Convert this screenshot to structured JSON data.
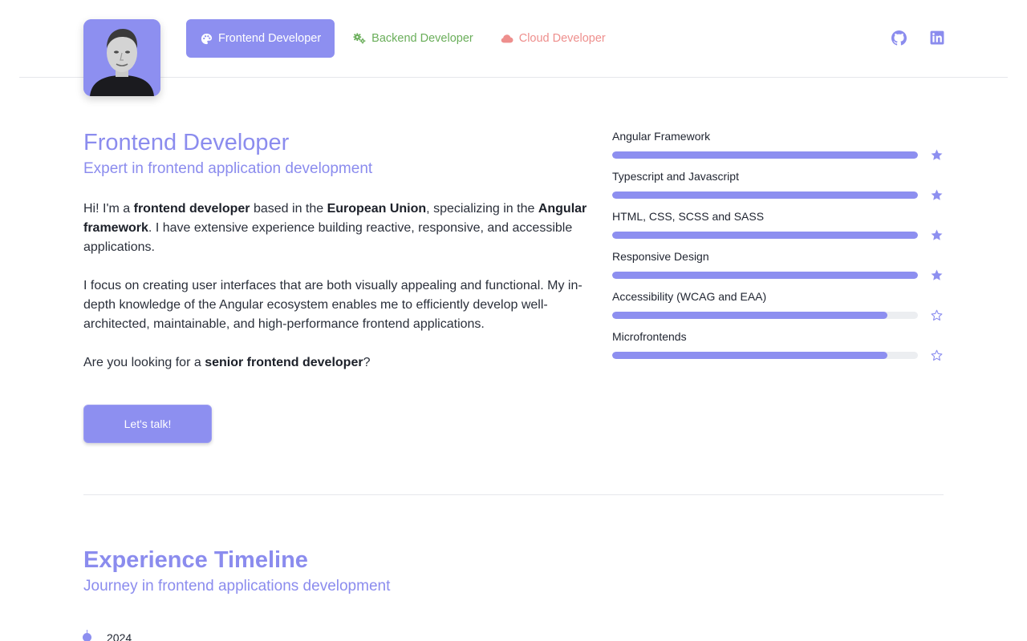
{
  "nav": {
    "tabs": [
      {
        "label": "Frontend Developer",
        "icon": "palette-icon"
      },
      {
        "label": "Backend Developer",
        "icon": "gears-icon"
      },
      {
        "label": "Cloud Developer",
        "icon": "cloud-icon"
      }
    ],
    "social": [
      "github-icon",
      "linkedin-icon"
    ]
  },
  "hero": {
    "title": "Frontend Developer",
    "subtitle": "Expert in frontend application development",
    "p1": {
      "t1": "Hi! I'm a ",
      "b1": "frontend developer",
      "t2": " based in the ",
      "b2": "European Union",
      "t3": ", specializing in the ",
      "b3": "Angular framework",
      "t4": ". I have extensive experience building reactive, responsive, and accessible applications."
    },
    "p2": "I focus on creating user interfaces that are both visually appealing and functional. My in-depth knowledge of the Angular ecosystem enables me to efficiently develop well-architected, maintainable, and high-performance frontend applications.",
    "p3": {
      "t1": "Are you looking for a ",
      "b1": "senior frontend developer",
      "t2": "?"
    },
    "cta": "Let's talk!"
  },
  "skills": [
    {
      "name": "Angular Framework",
      "level": 100,
      "star": "filled"
    },
    {
      "name": "Typescript and Javascript",
      "level": 100,
      "star": "filled"
    },
    {
      "name": "HTML, CSS, SCSS and SASS",
      "level": 100,
      "star": "filled"
    },
    {
      "name": "Responsive Design",
      "level": 100,
      "star": "filled"
    },
    {
      "name": "Accessibility (WCAG and EAA)",
      "level": 90,
      "star": "outline"
    },
    {
      "name": "Microfrontends",
      "level": 90,
      "star": "outline"
    }
  ],
  "timeline": {
    "title": "Experience Timeline",
    "subtitle": "Journey in frontend applications development",
    "first_year": "2024"
  },
  "colors": {
    "accent": "#8d8ff0",
    "backend": "#6aae5a",
    "cloud": "#ee8f8d"
  }
}
